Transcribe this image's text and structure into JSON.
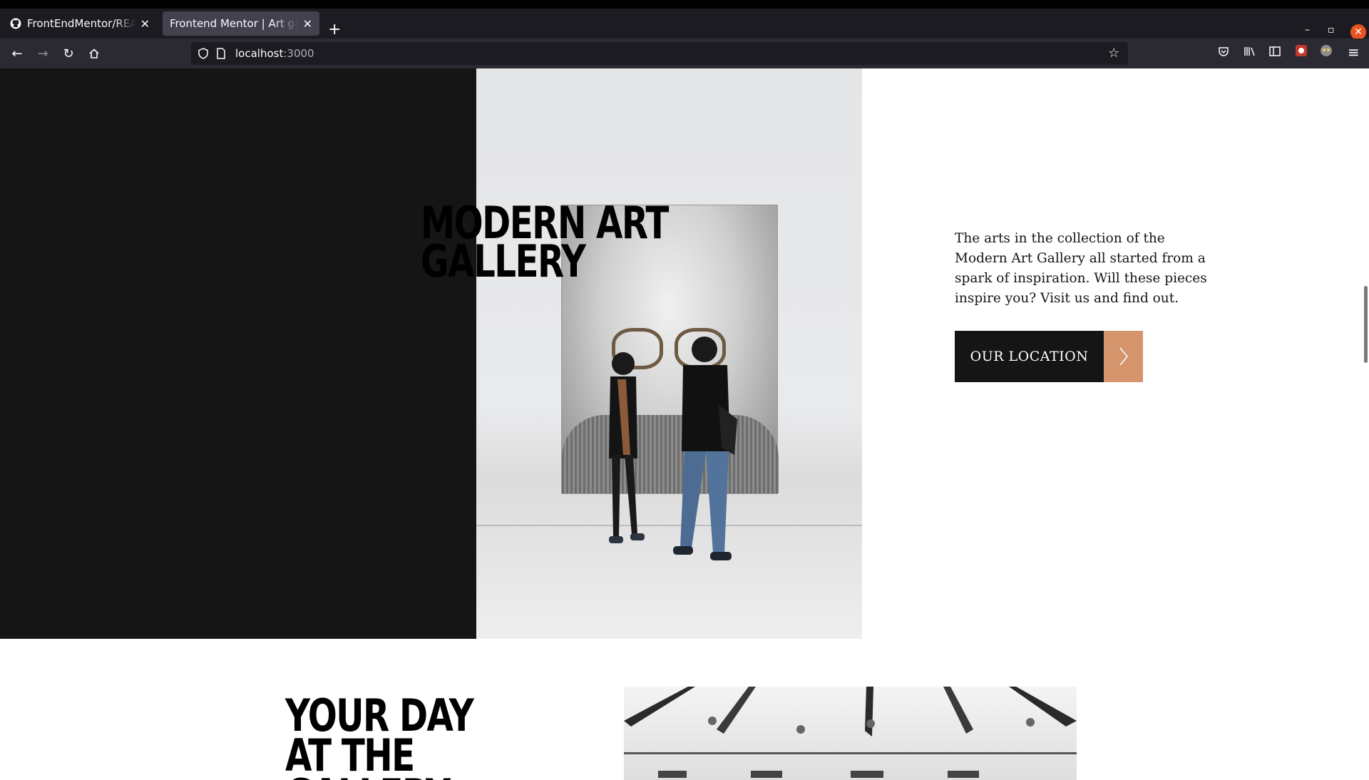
{
  "browser": {
    "tabs": [
      {
        "title": "FrontEndMentor/READM",
        "icon": "github-icon"
      },
      {
        "title": "Frontend Mentor | Art galler",
        "icon": ""
      }
    ],
    "url_host": "localhost",
    "url_port": ":3000"
  },
  "hero": {
    "title": "MODERN ART GALLERY",
    "description": "The arts in the collection of the Modern Art Gallery all started from a spark of inspiration. Will these pieces inspire you? Visit us and find out.",
    "button_label": "OUR LOCATION",
    "accent_color": "#d5956c",
    "dark_color": "#151515"
  },
  "section2": {
    "title": "YOUR DAY AT THE GALLERY"
  }
}
